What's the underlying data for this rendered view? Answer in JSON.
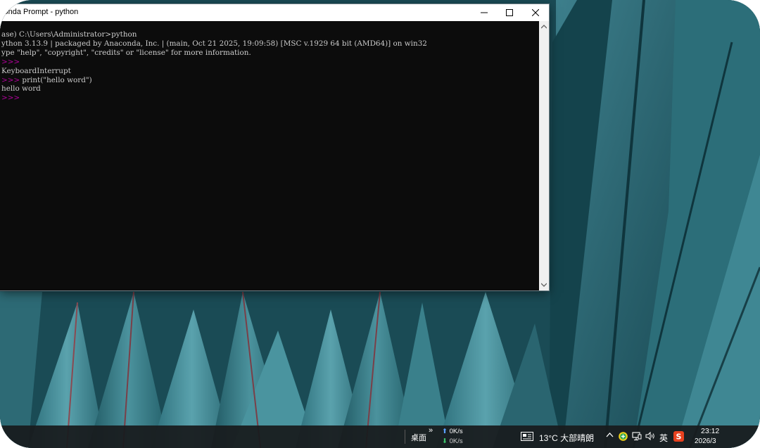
{
  "window": {
    "title": "conda Prompt - python",
    "controls": {
      "minimize": "minimize-icon",
      "maximize": "maximize-icon",
      "close": "close-icon"
    }
  },
  "console": {
    "lines": [
      "ase) C:\\Users\\Administrator>python",
      "ython 3.13.9 | packaged by Anaconda, Inc. | (main, Oct 21 2025, 19:09:58) [MSC v.1929 64 bit (AMD64)] on win32",
      "ype \"help\", \"copyright\", \"credits\" or \"license\" for more information.",
      ">>>",
      "KeyboardInterrupt",
      ">>> print(\"hello word\")",
      "hello word",
      ">>>"
    ],
    "prompt_color": "#b4009e",
    "text_color": "#cccccc"
  },
  "taskbar": {
    "desktop_label": "桌面",
    "overflow": "»",
    "net_up": "0K/s",
    "net_down": "0K/s",
    "weather": "13°C  大部晴朗",
    "ime": "英",
    "time": "23:12",
    "date": "2026/3",
    "icons": [
      "chevron-up-icon",
      "green-plus-icon",
      "network-icon",
      "volume-icon",
      "sogou-icon",
      "weather-icon"
    ]
  },
  "colors": {
    "taskbar": "#181c1e",
    "console_bg": "#0c0c0c",
    "titlebar": "#ffffff"
  }
}
